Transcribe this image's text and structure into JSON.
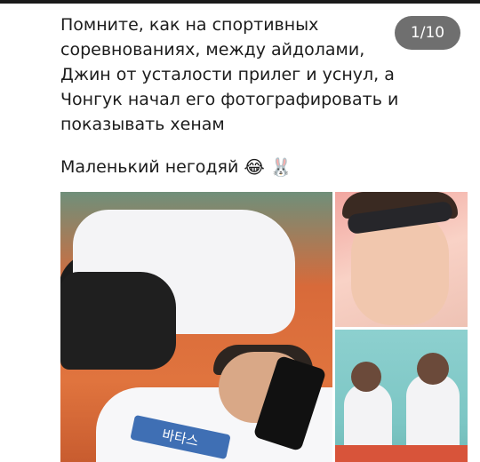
{
  "post": {
    "text": "Помните, как на спортивных\nсоревнованиях, между айдолами,\nДжин от усталости прилег и уснул, а\nЧонгук начал его фотографировать и\nпоказывать хенам",
    "caption": "Маленький негодяй",
    "emojis": [
      "😂",
      "🐰"
    ]
  },
  "gallery": {
    "counter": "1/10",
    "images": [
      {
        "name": "main-photo",
        "overlay_text": "바타스"
      },
      {
        "name": "closeup-photo"
      },
      {
        "name": "group-photo"
      }
    ]
  },
  "colors": {
    "text": "#1c1c1c",
    "counter_bg": "#464646"
  }
}
